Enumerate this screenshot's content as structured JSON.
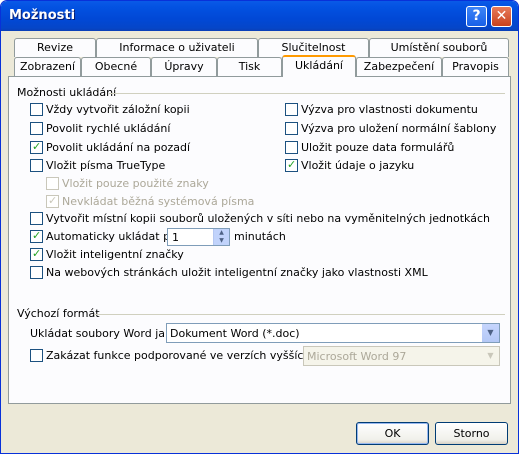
{
  "window": {
    "title": "Možnosti",
    "help_glyph": "?",
    "close_glyph": "✕"
  },
  "tabs_row1": [
    "Revize",
    "Informace o uživateli",
    "Slučitelnost",
    "Umístění souborů"
  ],
  "tabs_row2": [
    "Zobrazení",
    "Obecné",
    "Úpravy",
    "Tisk",
    "Ukládání",
    "Zabezpečení",
    "Pravopis"
  ],
  "active_tab": "Ukládání",
  "save_group": {
    "title": "Možnosti ukládání",
    "left": [
      {
        "label": "Vždy vytvořit záložní kopii",
        "checked": false,
        "disabled": false
      },
      {
        "label": "Povolit rychlé ukládání",
        "checked": false,
        "disabled": false
      },
      {
        "label": "Povolit ukládání na pozadí",
        "checked": true,
        "disabled": false
      },
      {
        "label": "Vložit písma TrueType",
        "checked": false,
        "disabled": false
      },
      {
        "label": "Vložit pouze použité znaky",
        "checked": false,
        "disabled": true
      },
      {
        "label": "Nevkládat běžná systémová písma",
        "checked": true,
        "disabled": true
      }
    ],
    "right": [
      {
        "label": "Výzva pro vlastnosti dokumentu",
        "checked": false
      },
      {
        "label": "Výzva pro uložení normální šablony",
        "checked": false
      },
      {
        "label": "Uložit pouze data formulářů",
        "checked": false
      },
      {
        "label": "Vložit údaje o jazyku",
        "checked": true
      }
    ],
    "local_copy": {
      "label": "Vytvořit místní kopii souborů uložených v síti nebo na vyměnitelných jednotkách",
      "checked": false
    },
    "autosave": {
      "label": "Automaticky ukládat po:",
      "checked": true,
      "value": "1",
      "unit": "minutách"
    },
    "smart_tags": {
      "label": "Vložit inteligentní značky",
      "checked": true
    },
    "xml_tags": {
      "label": "Na webových stránkách uložit inteligentní značky jako vlastnosti XML",
      "checked": false
    }
  },
  "default_format": {
    "title": "Výchozí formát",
    "save_as_label": "Ukládat soubory Word jako:",
    "save_as_value": "Dokument Word (*.doc)",
    "disable_label": "Zakázat funkce podporované ve verzích vyšších než:",
    "disable_checked": false,
    "disable_value": "Microsoft Word 97"
  },
  "buttons": {
    "ok": "OK",
    "cancel": "Storno"
  }
}
